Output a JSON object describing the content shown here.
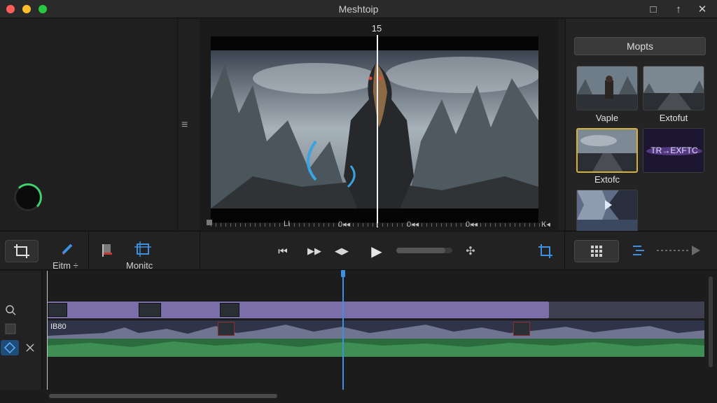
{
  "window": {
    "title": "Meshtoip",
    "controls": [
      "□",
      "↑",
      "✕"
    ]
  },
  "viewer": {
    "timecode": "15",
    "side_menu_icon": "≡",
    "ruler_labels": [
      "LI",
      "0◂◂",
      "0◂◂",
      "0◂◂",
      "K◂"
    ]
  },
  "right_panel": {
    "tab_label": "Mopts",
    "thumbnails": [
      {
        "label": "Vaple",
        "icon": "thumbnail-character",
        "selected": false
      },
      {
        "label": "Extofut",
        "icon": "thumbnail-road",
        "selected": false
      },
      {
        "label": "Extofc",
        "icon": "thumbnail-landscape",
        "selected": true
      },
      {
        "label": "",
        "icon": "thumbnail-transition",
        "text_in_thumb": "TR→EXFTC",
        "selected": false
      },
      {
        "label": "",
        "icon": "thumbnail-gradient",
        "selected": false
      }
    ]
  },
  "toolbar": {
    "crop_icon": "crop-icon",
    "edit_label": "Eitm ÷",
    "monitor_label": "Monitc",
    "transport": [
      "⏮",
      "▶▶",
      "◀▶",
      "▶"
    ],
    "scrub_level": 0.88,
    "move_icon": "✣",
    "grid_icon": "grid-icon",
    "filter_icon": "filter-icon"
  },
  "timeline": {
    "audio_track_label": "IB80",
    "lane_icons": [
      "search-replace-icon",
      "square-icon",
      "diamond-icon",
      "close-icon"
    ]
  },
  "colors": {
    "accent_blue": "#3d8fe0",
    "clip_purple": "#7c6ea8",
    "audio_green": "#2c6b3e",
    "selection_gold": "#d6b13a"
  }
}
